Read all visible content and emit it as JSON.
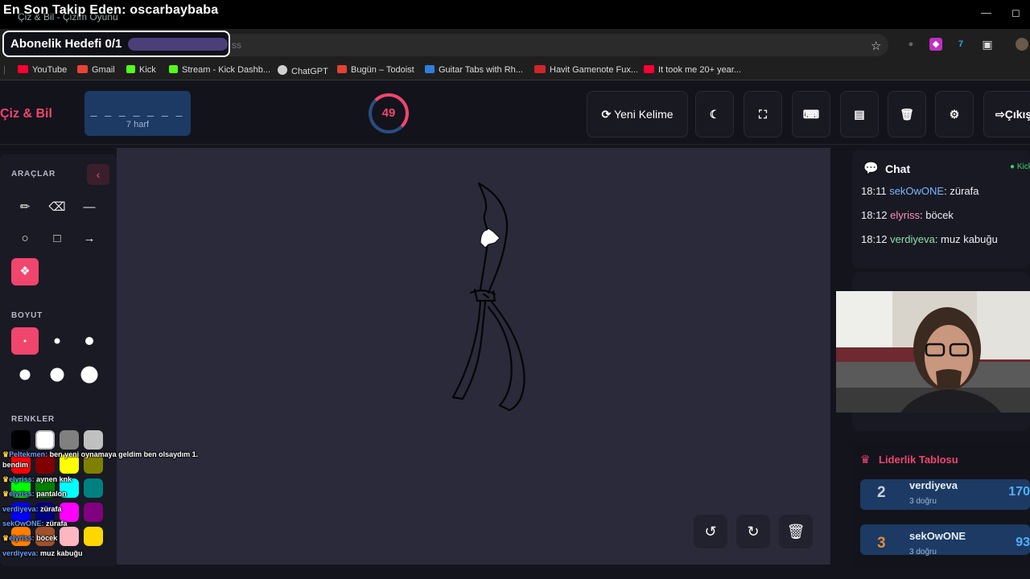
{
  "browser": {
    "tab_title": "Çiz & Bil - Çizim Oyunu",
    "url_suffix": "ss",
    "bookmarks": [
      {
        "label": "YouTube",
        "color": "#ff0033"
      },
      {
        "label": "Gmail",
        "color": "#ea4335"
      },
      {
        "label": "Kick",
        "color": "#53fc18"
      },
      {
        "label": "Stream - Kick Dashb...",
        "color": "#53fc18"
      },
      {
        "label": "ChatGPT",
        "color": "#d0d0d0"
      },
      {
        "label": "Bugün – Todoist",
        "color": "#e44332"
      },
      {
        "label": "Guitar Tabs with Rh...",
        "color": "#2d7fe0"
      },
      {
        "label": "Havit Gamenote Fux...",
        "color": "#d0262c"
      },
      {
        "label": "It took me 20+ year...",
        "color": "#ff0033"
      }
    ]
  },
  "overlay": {
    "latest_follower": "En Son Takip Eden: oscarbaybaba",
    "sub_goal": "Abonelik Hedefi 0/1",
    "sub_goal_progress": 0,
    "chat": [
      {
        "user": "Peltekmen:",
        "text": "ben yeni oynamaya geldim ben olsaydım 1.",
        "crown": true
      },
      {
        "user": "",
        "text": "bendim",
        "crown": false
      },
      {
        "user": "elyriss:",
        "text": "aynen knk",
        "crown": true
      },
      {
        "user": "elyriss:",
        "text": "pantalon",
        "crown": true
      },
      {
        "user": "verdiyeva:",
        "text": "zürafa",
        "crown": false
      },
      {
        "user": "sekOwONE:",
        "text": "zürafa",
        "crown": false
      },
      {
        "user": "elyriss:",
        "text": "böcek",
        "crown": true
      },
      {
        "user": "verdiyeva:",
        "text": "muz kabuğu",
        "crown": false
      }
    ]
  },
  "header": {
    "logo": "Çiz & Bil",
    "word_dashes": "_ _ _ _ _ _ _",
    "word_length": "7 harf",
    "timer": "49",
    "new_word": "Yeni Kelime",
    "exit": "Çıkış"
  },
  "tools": {
    "tools_title": "ARAÇLAR",
    "size_title": "BOYUT",
    "colors_title": "RENKLER",
    "colors": [
      "#000000",
      "#ffffff",
      "#808080",
      "#c0c0c0",
      "#ff0000",
      "#800000",
      "#ffff00",
      "#808000",
      "#00ff00",
      "#008000",
      "#00ffff",
      "#008080",
      "#0000ff",
      "#000080",
      "#ff00ff",
      "#800080",
      "#ff8000",
      "#a0522d",
      "#ffb6c1",
      "#ffd700"
    ]
  },
  "chat": {
    "title": "Chat",
    "status": "Kick",
    "messages": [
      {
        "time": "18:11",
        "user": "sekOwONE",
        "text": ": zürafa",
        "color": "cu-blue"
      },
      {
        "time": "18:12",
        "user": "elyriss",
        "text": ": böcek",
        "color": "cu-pink"
      },
      {
        "time": "18:12",
        "user": "verdiyeva",
        "text": ": muz kabuğu",
        "color": "cu-green"
      }
    ]
  },
  "leaderboard": {
    "title": "Liderlik Tablosu",
    "rows": [
      {
        "rank": "2",
        "name": "verdiyeva",
        "detail": "3 doğru",
        "score": "170",
        "rank_color": "#c8d2e0"
      },
      {
        "rank": "3",
        "name": "sekOwONE",
        "detail": "3 doğru",
        "score": "93",
        "rank_color": "#e08a3c"
      }
    ]
  }
}
